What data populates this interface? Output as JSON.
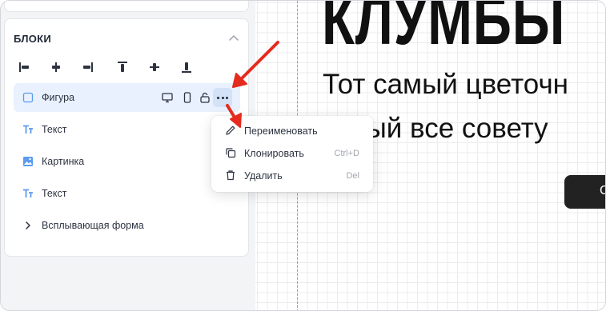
{
  "sidebar": {
    "title": "БЛОКИ",
    "layers": [
      {
        "label": "Фигура",
        "icon": "square-shape-icon",
        "selected": true
      },
      {
        "label": "Текст",
        "icon": "text-icon"
      },
      {
        "label": "Картинка",
        "icon": "image-icon"
      },
      {
        "label": "Текст",
        "icon": "text-icon"
      },
      {
        "label": "Всплывающая форма",
        "icon": "chevron-right-icon"
      }
    ]
  },
  "context_menu": {
    "items": [
      {
        "label": "Переименовать",
        "shortcut": "",
        "icon": "pencil-icon"
      },
      {
        "label": "Клонировать",
        "shortcut": "Ctrl+D",
        "icon": "clone-icon"
      },
      {
        "label": "Удалить",
        "shortcut": "Del",
        "icon": "trash-icon"
      }
    ]
  },
  "canvas": {
    "heading": "КЛУМБЫ",
    "subtitle_line1": "Тот самый цветочн",
    "subtitle_line2": "торый все совету",
    "button_char": "С"
  },
  "colors": {
    "accent_arrow": "#e52a1e",
    "selected_row": "#e8f1fd",
    "panel_bg": "#f3f4f6"
  }
}
